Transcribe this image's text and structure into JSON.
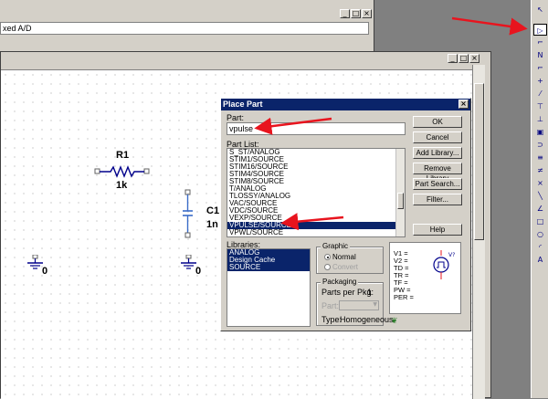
{
  "back_window": {
    "address_text": "xed A/D"
  },
  "window_controls": {
    "minimize": "_",
    "maximize": "□",
    "close": "×"
  },
  "schematic": {
    "r1_name": "R1",
    "r1_value": "1k",
    "c1_name": "C1",
    "c1_value": "1n",
    "ground_left_label": "0",
    "ground_right_label": "0"
  },
  "dialog": {
    "title": "Place Part",
    "part_label": "Part:",
    "part_value": "vpulse",
    "part_list_label": "Part List:",
    "part_list": [
      "S_ST/ANALOG",
      "STIM1/SOURCE",
      "STIM16/SOURCE",
      "STIM4/SOURCE",
      "STIM8/SOURCE",
      "T/ANALOG",
      "TLOSSY/ANALOG",
      "VAC/SOURCE",
      "VDC/SOURCE",
      "VEXP/SOURCE",
      "VPULSE/SOURCE",
      "VPWL/SOURCE"
    ],
    "selected_part": "VPULSE/SOURCE",
    "libraries_label": "Libraries:",
    "libraries": [
      "ANALOG",
      "Design Cache",
      "SOURCE"
    ],
    "buttons": {
      "ok": "OK",
      "cancel": "Cancel",
      "add_library": "Add Library...",
      "remove_library": "Remove Library",
      "part_search": "Part Search...",
      "filter": "Filter...",
      "help": "Help"
    },
    "graphic": {
      "title": "Graphic",
      "normal": "Normal",
      "convert": "Convert",
      "selected": "Normal"
    },
    "packaging": {
      "title": "Packaging",
      "parts_per_pkg_label": "Parts per Pkg:",
      "parts_per_pkg_value": "1",
      "part_label": "Part:",
      "type_label": "Type:",
      "type_value": "Homogeneous"
    },
    "preview": {
      "lines": [
        "V1 =",
        "V2 =",
        "TD =",
        "TR =",
        "TF =",
        "PW =",
        "PER ="
      ],
      "symbol_label": "V?"
    }
  },
  "colors": {
    "arrow": "#e8141e",
    "title_bar": "#0a246a",
    "component": "#00008b",
    "capacitor": "#3a6cc8"
  },
  "toolbar_icons": [
    "select-arrow-icon",
    "place-part-icon",
    "wire-icon",
    "net-alias-icon",
    "bus-icon",
    "junction-icon",
    "bus-entry-icon",
    "power-icon",
    "ground-icon",
    "off-page-icon",
    "hierarchical-block-icon",
    "hierarchical-port-icon",
    "hierarchical-pin-icon",
    "no-connect-icon",
    "line-icon",
    "polyline-icon",
    "rectangle-icon",
    "ellipse-icon",
    "arc-icon",
    "text-icon"
  ]
}
